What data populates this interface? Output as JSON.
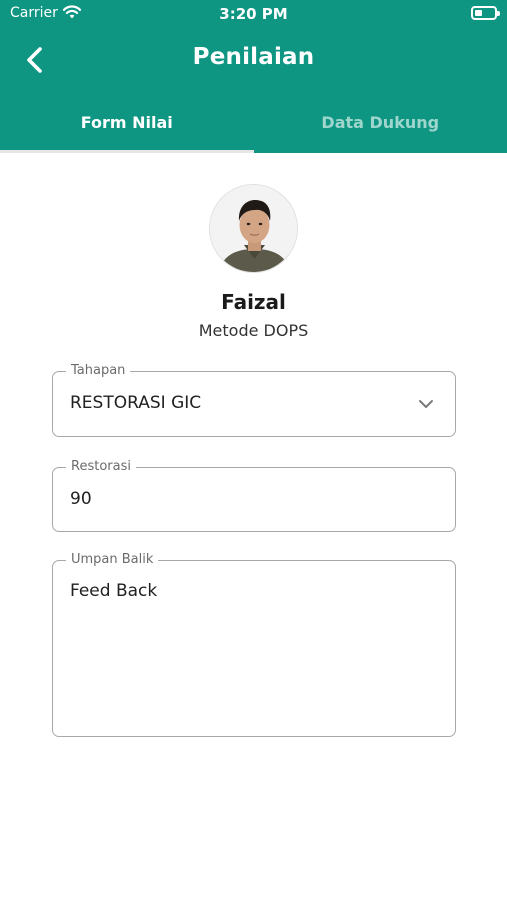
{
  "status_bar": {
    "carrier": "Carrier",
    "time": "3:20 PM"
  },
  "header": {
    "title": "Penilaian",
    "back_icon": "chevron-left-icon"
  },
  "tabs": [
    {
      "label": "Form Nilai",
      "active": true
    },
    {
      "label": "Data Dukung",
      "active": false
    }
  ],
  "profile": {
    "name": "Faizal",
    "method": "Metode DOPS"
  },
  "form": {
    "tahapan": {
      "label": "Tahapan",
      "value": "RESTORASI GIC"
    },
    "restorasi": {
      "label": "Restorasi",
      "value": "90"
    },
    "umpan_balik": {
      "label": "Umpan Balik",
      "value": "Feed Back"
    }
  },
  "colors": {
    "primary": "#0e9683",
    "border": "#a8a8a8",
    "background": "#ffffff"
  }
}
